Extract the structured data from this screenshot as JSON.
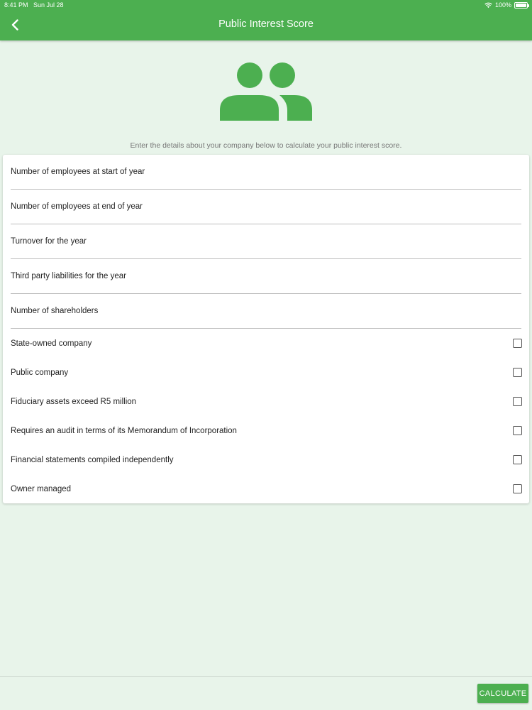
{
  "status_bar": {
    "time": "8:41 PM",
    "date": "Sun Jul 28",
    "battery": "100%"
  },
  "nav": {
    "title": "Public Interest Score"
  },
  "intro": "Enter the details about your company below to calculate your public interest score.",
  "fields": [
    {
      "placeholder": "Number of employees at start of year",
      "value": ""
    },
    {
      "placeholder": "Number of employees at end of year",
      "value": ""
    },
    {
      "placeholder": "Turnover for the year",
      "value": ""
    },
    {
      "placeholder": "Third party liabilities for the year",
      "value": ""
    },
    {
      "placeholder": "Number of shareholders",
      "value": ""
    }
  ],
  "checkboxes": [
    {
      "label": "State-owned company",
      "checked": false
    },
    {
      "label": "Public company",
      "checked": false
    },
    {
      "label": "Fiduciary assets exceed R5 million",
      "checked": false
    },
    {
      "label": "Requires an audit in terms of its Memorandum of Incorporation",
      "checked": false
    },
    {
      "label": "Financial statements compiled independently",
      "checked": false
    },
    {
      "label": "Owner managed",
      "checked": false
    }
  ],
  "footer": {
    "calculate_label": "CALCULATE"
  },
  "colors": {
    "accent": "#4caf50",
    "background": "#e8f4ea"
  },
  "icons": {
    "hero": "people-icon",
    "back": "chevron-left-icon"
  }
}
